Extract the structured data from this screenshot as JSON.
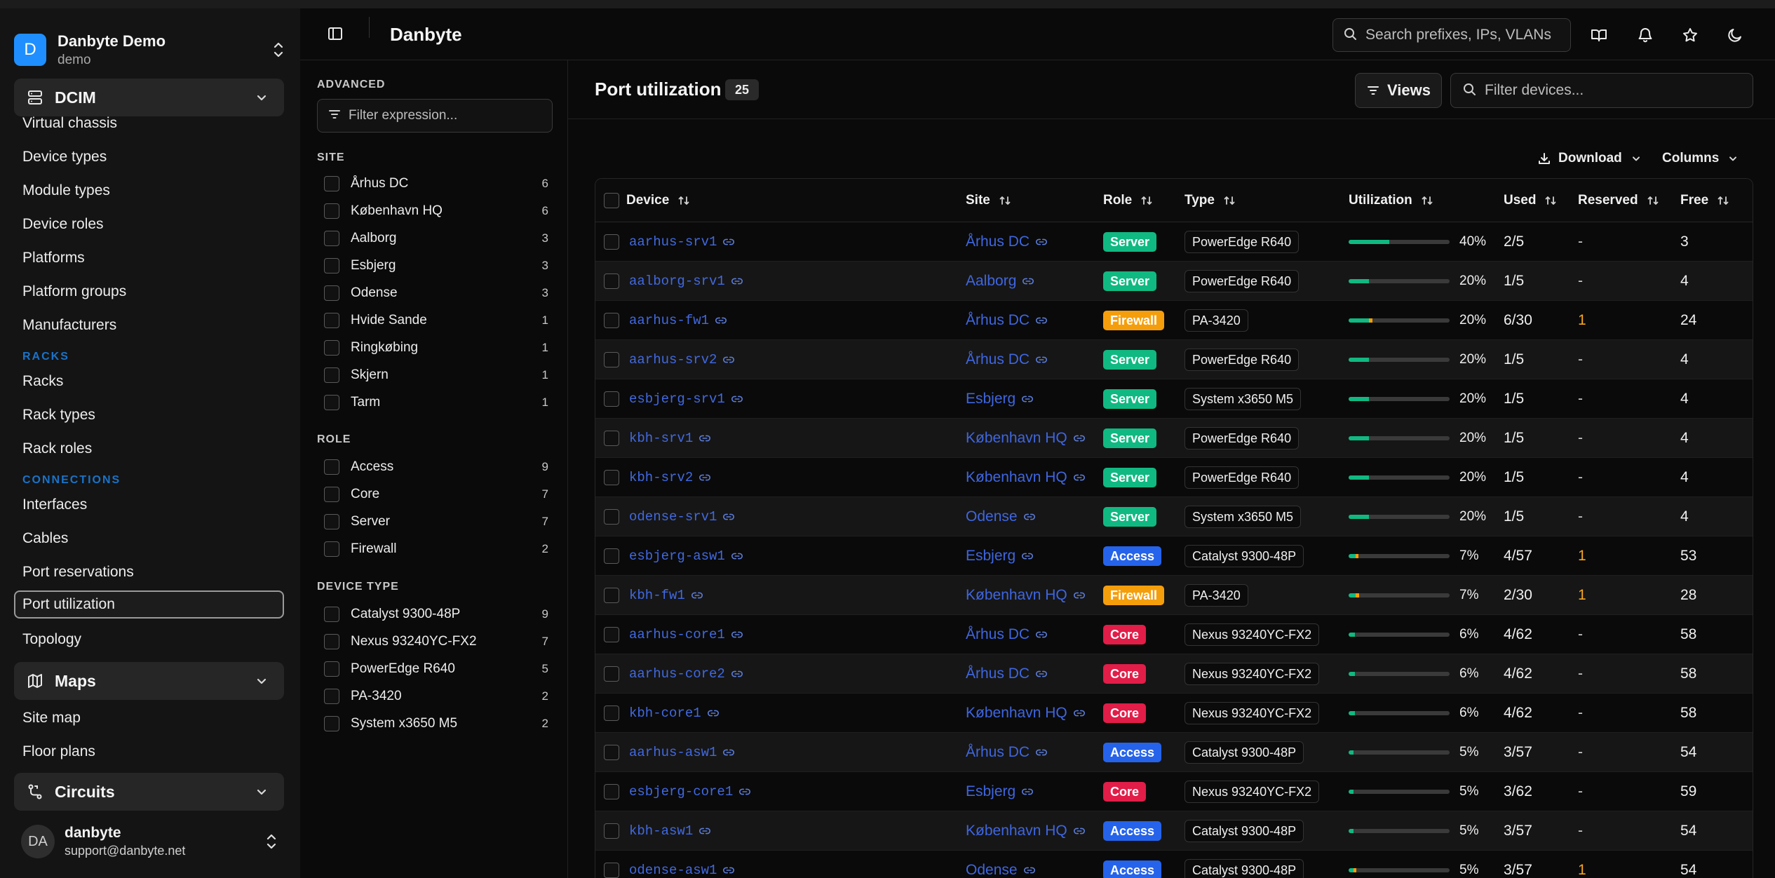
{
  "workspace": {
    "initial": "D",
    "name": "Danbyte Demo",
    "sub": "demo"
  },
  "sidebar": {
    "dcim": {
      "label": "DCIM"
    },
    "dcim_items": [
      "Virtual chassis",
      "Device types",
      "Module types",
      "Device roles",
      "Platforms",
      "Platform groups",
      "Manufacturers"
    ],
    "racks_section": "RACKS",
    "racks_items": [
      "Racks",
      "Rack types",
      "Rack roles"
    ],
    "connections_section": "CONNECTIONS",
    "connections_items": [
      "Interfaces",
      "Cables",
      "Port reservations",
      "Port utilization",
      "Topology"
    ],
    "maps": {
      "label": "Maps"
    },
    "maps_items": [
      "Site map",
      "Floor plans"
    ],
    "circuits": {
      "label": "Circuits"
    }
  },
  "user": {
    "initials": "DA",
    "name": "danbyte",
    "email": "support@danbyte.net"
  },
  "header": {
    "title": "Danbyte",
    "search_placeholder": "Search prefixes, IPs, VLANs"
  },
  "filters": {
    "advanced_label": "ADVANCED",
    "expression_placeholder": "Filter expression...",
    "site_label": "SITE",
    "sites": [
      {
        "label": "Århus DC",
        "count": "6"
      },
      {
        "label": "København HQ",
        "count": "6"
      },
      {
        "label": "Aalborg",
        "count": "3"
      },
      {
        "label": "Esbjerg",
        "count": "3"
      },
      {
        "label": "Odense",
        "count": "3"
      },
      {
        "label": "Hvide Sande",
        "count": "1"
      },
      {
        "label": "Ringkøbing",
        "count": "1"
      },
      {
        "label": "Skjern",
        "count": "1"
      },
      {
        "label": "Tarm",
        "count": "1"
      }
    ],
    "role_label": "ROLE",
    "roles": [
      {
        "label": "Access",
        "count": "9"
      },
      {
        "label": "Core",
        "count": "7"
      },
      {
        "label": "Server",
        "count": "7"
      },
      {
        "label": "Firewall",
        "count": "2"
      }
    ],
    "type_label": "DEVICE TYPE",
    "types": [
      {
        "label": "Catalyst 9300-48P",
        "count": "9"
      },
      {
        "label": "Nexus 93240YC-FX2",
        "count": "7"
      },
      {
        "label": "PowerEdge R640",
        "count": "5"
      },
      {
        "label": "PA-3420",
        "count": "2"
      },
      {
        "label": "System x3650 M5",
        "count": "2"
      }
    ]
  },
  "main": {
    "title": "Port utilization",
    "count": "25",
    "views_label": "Views",
    "filter_placeholder": "Filter devices...",
    "download_label": "Download",
    "columns_label": "Columns"
  },
  "table": {
    "headers": {
      "device": "Device",
      "site": "Site",
      "role": "Role",
      "type": "Type",
      "utilization": "Utilization",
      "used": "Used",
      "reserved": "Reserved",
      "free": "Free"
    },
    "role_colors": {
      "Server": "#10b981",
      "Firewall": "#f59e0b",
      "Access": "#2563eb",
      "Core": "#e11d48"
    },
    "rows": [
      {
        "device": "aarhus-srv1",
        "site": "Århus DC",
        "role": "Server",
        "type": "PowerEdge R640",
        "pct": 40,
        "reserved_pct": 0,
        "util": "40%",
        "used": "2/5",
        "reserved": "-",
        "free": "3"
      },
      {
        "device": "aalborg-srv1",
        "site": "Aalborg",
        "role": "Server",
        "type": "PowerEdge R640",
        "pct": 20,
        "reserved_pct": 0,
        "util": "20%",
        "used": "1/5",
        "reserved": "-",
        "free": "4"
      },
      {
        "device": "aarhus-fw1",
        "site": "Århus DC",
        "role": "Firewall",
        "type": "PA-3420",
        "pct": 20,
        "reserved_pct": 3.3,
        "util": "20%",
        "used": "6/30",
        "reserved": "1",
        "free": "24"
      },
      {
        "device": "aarhus-srv2",
        "site": "Århus DC",
        "role": "Server",
        "type": "PowerEdge R640",
        "pct": 20,
        "reserved_pct": 0,
        "util": "20%",
        "used": "1/5",
        "reserved": "-",
        "free": "4"
      },
      {
        "device": "esbjerg-srv1",
        "site": "Esbjerg",
        "role": "Server",
        "type": "System x3650 M5",
        "pct": 20,
        "reserved_pct": 0,
        "util": "20%",
        "used": "1/5",
        "reserved": "-",
        "free": "4"
      },
      {
        "device": "kbh-srv1",
        "site": "København HQ",
        "role": "Server",
        "type": "PowerEdge R640",
        "pct": 20,
        "reserved_pct": 0,
        "util": "20%",
        "used": "1/5",
        "reserved": "-",
        "free": "4"
      },
      {
        "device": "kbh-srv2",
        "site": "København HQ",
        "role": "Server",
        "type": "PowerEdge R640",
        "pct": 20,
        "reserved_pct": 0,
        "util": "20%",
        "used": "1/5",
        "reserved": "-",
        "free": "4"
      },
      {
        "device": "odense-srv1",
        "site": "Odense",
        "role": "Server",
        "type": "System x3650 M5",
        "pct": 20,
        "reserved_pct": 0,
        "util": "20%",
        "used": "1/5",
        "reserved": "-",
        "free": "4"
      },
      {
        "device": "esbjerg-asw1",
        "site": "Esbjerg",
        "role": "Access",
        "type": "Catalyst 9300-48P",
        "pct": 7,
        "reserved_pct": 1.8,
        "util": "7%",
        "used": "4/57",
        "reserved": "1",
        "free": "53"
      },
      {
        "device": "kbh-fw1",
        "site": "København HQ",
        "role": "Firewall",
        "type": "PA-3420",
        "pct": 7,
        "reserved_pct": 3.3,
        "util": "7%",
        "used": "2/30",
        "reserved": "1",
        "free": "28"
      },
      {
        "device": "aarhus-core1",
        "site": "Århus DC",
        "role": "Core",
        "type": "Nexus 93240YC-FX2",
        "pct": 6,
        "reserved_pct": 0,
        "util": "6%",
        "used": "4/62",
        "reserved": "-",
        "free": "58"
      },
      {
        "device": "aarhus-core2",
        "site": "Århus DC",
        "role": "Core",
        "type": "Nexus 93240YC-FX2",
        "pct": 6,
        "reserved_pct": 0,
        "util": "6%",
        "used": "4/62",
        "reserved": "-",
        "free": "58"
      },
      {
        "device": "kbh-core1",
        "site": "København HQ",
        "role": "Core",
        "type": "Nexus 93240YC-FX2",
        "pct": 6,
        "reserved_pct": 0,
        "util": "6%",
        "used": "4/62",
        "reserved": "-",
        "free": "58"
      },
      {
        "device": "aarhus-asw1",
        "site": "Århus DC",
        "role": "Access",
        "type": "Catalyst 9300-48P",
        "pct": 5,
        "reserved_pct": 0,
        "util": "5%",
        "used": "3/57",
        "reserved": "-",
        "free": "54"
      },
      {
        "device": "esbjerg-core1",
        "site": "Esbjerg",
        "role": "Core",
        "type": "Nexus 93240YC-FX2",
        "pct": 5,
        "reserved_pct": 0,
        "util": "5%",
        "used": "3/62",
        "reserved": "-",
        "free": "59"
      },
      {
        "device": "kbh-asw1",
        "site": "København HQ",
        "role": "Access",
        "type": "Catalyst 9300-48P",
        "pct": 5,
        "reserved_pct": 0,
        "util": "5%",
        "used": "3/57",
        "reserved": "-",
        "free": "54"
      },
      {
        "device": "odense-asw1",
        "site": "Odense",
        "role": "Access",
        "type": "Catalyst 9300-48P",
        "pct": 5,
        "reserved_pct": 1.8,
        "util": "5%",
        "used": "3/57",
        "reserved": "1",
        "free": "54"
      }
    ]
  }
}
